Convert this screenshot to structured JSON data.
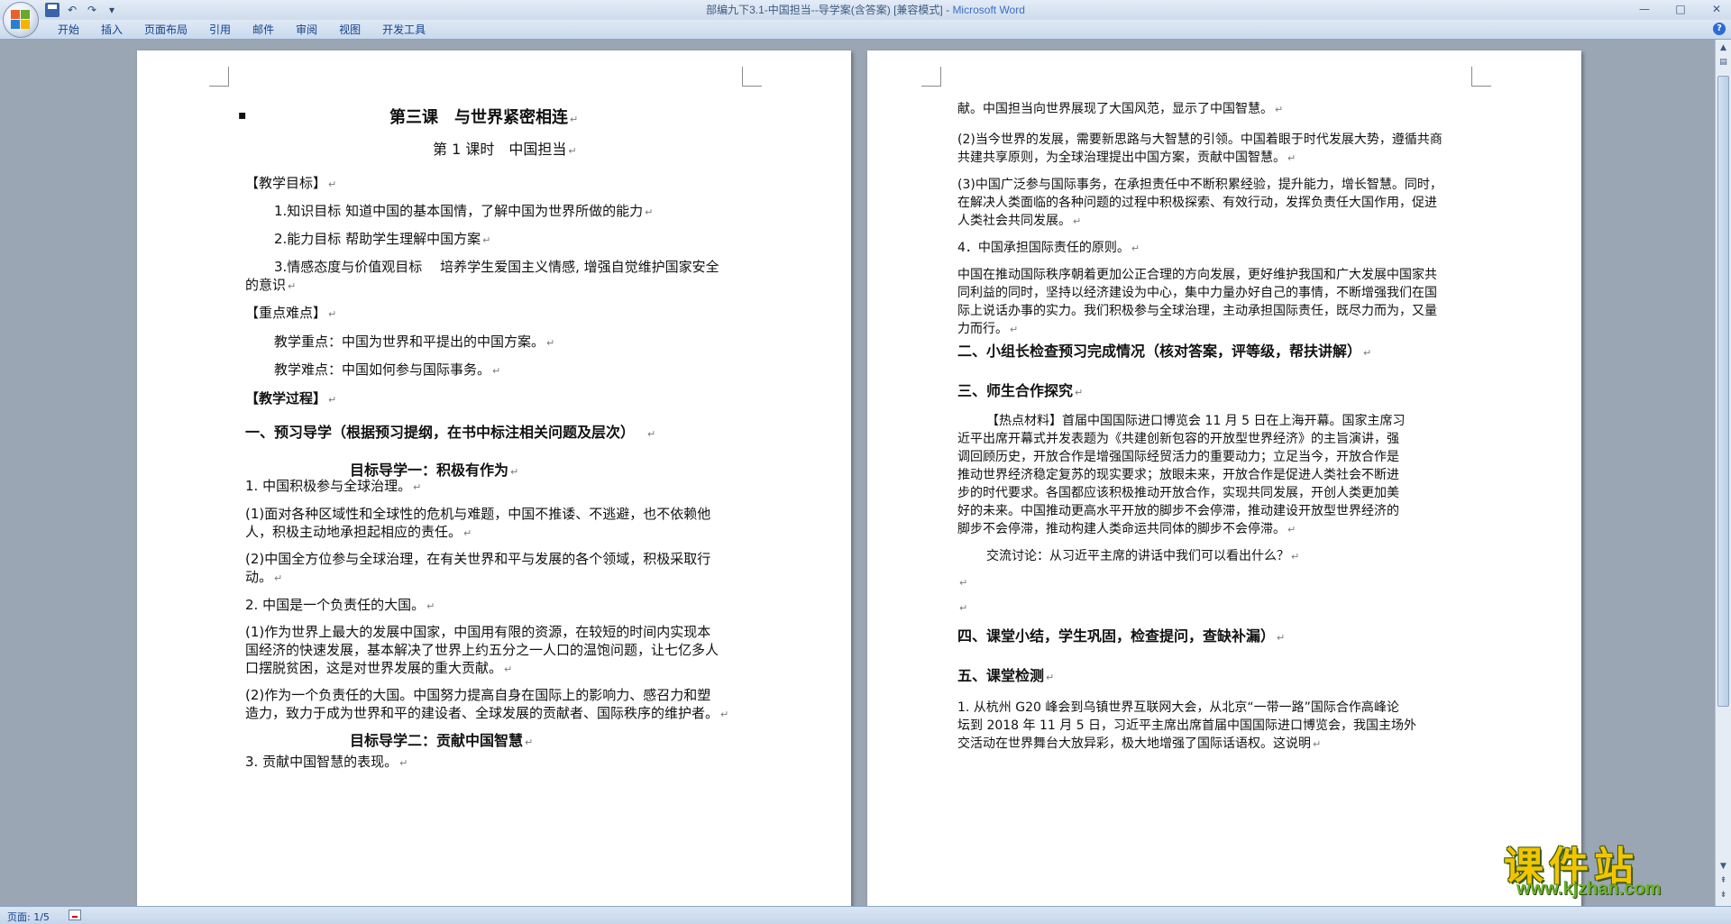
{
  "window": {
    "title": "部编九下3.1-中国担当--导学案(含答案) [兼容模式] - ",
    "app_name": "Microsoft Word",
    "controls": [
      "minimize-icon",
      "maximize-icon",
      "close-icon"
    ]
  },
  "quick_access": [
    "save-icon",
    "undo-icon",
    "redo-icon",
    "customize-icon"
  ],
  "ribbon": {
    "tabs": [
      "开始",
      "插入",
      "页面布局",
      "引用",
      "邮件",
      "审阅",
      "视图",
      "开发工具"
    ]
  },
  "status": {
    "page": "页面: 1/5"
  },
  "watermark": {
    "title": "课件站",
    "url": "www.kjzhan.com"
  },
  "page1": {
    "bullet": "▪",
    "title": "第三课　与世界紧密相连",
    "subtitle": "第 1 课时　中国担当",
    "goals_heading": "【教学目标】",
    "goal1": "1.知识目标 知道中国的基本国情，了解中国为世界所做的能力",
    "goal2": "2.能力目标 帮助学生理解中国方案",
    "goal3a": "3.情感态度与价值观目标　 培养学生爱国主义情感, 增强自觉维护国家安全",
    "goal3b": "的意识",
    "key_heading": "【重点难点】",
    "key1": "教学重点：中国为世界和平提出的中国方案。",
    "key2": "教学难点：中国如何参与国际事务。",
    "process_heading": "【教学过程】",
    "sec1": "一、预习导学（根据预习提纲，在书中标注相关问题及层次）",
    "target1": "目标导学一：积极有作为",
    "p1": "1.  中国积极参与全球治理。",
    "p1a1": "(1)面对各种区域性和全球性的危机与难题，中国不推诿、不逃避，也不依赖他",
    "p1a2": "人，积极主动地承担起相应的责任。",
    "p1b1": "(2)中国全方位参与全球治理，在有关世界和平与发展的各个领域，积极采取行",
    "p1b2": "动。",
    "p2": "2.  中国是一个负责任的大国。",
    "p2a1": "(1)作为世界上最大的发展中国家，中国用有限的资源，在较短的时间内实现本",
    "p2a2": "国经济的快速发展，基本解决了世界上约五分之一人口的温饱问题，让七亿多人",
    "p2a3": "口摆脱贫困，这是对世界发展的重大贡献。",
    "p2b1": "(2)作为一个负责任的大国。中国努力提高自身在国际上的影响力、感召力和塑",
    "p2b2": "造力，致力于成为世界和平的建设者、全球发展的贡献者、国际秩序的维护者。",
    "target2": "目标导学二：贡献中国智慧",
    "p3": "3.  贡献中国智慧的表现。"
  },
  "page2": {
    "l1": "献。中国担当向世界展现了大国风范，显示了中国智慧。",
    "a1": "(2)当今世界的发展，需要新思路与大智慧的引领。中国着眼于时代发展大势，遵循共商",
    "a2": "共建共享原则，为全球治理提出中国方案，贡献中国智慧。",
    "b1": "(3)中国广泛参与国际事务，在承担责任中不断积累经验，提升能力，增长智慧。同时，",
    "b2": "在解决人类面临的各种问题的过程中积极探索、有效行动，发挥负责任大国作用，促进",
    "b3": "人类社会共同发展。",
    "c": "4．中国承担国际责任的原则。",
    "d1": "中国在推动国际秩序朝着更加公正合理的方向发展，更好维护我国和广大发展中国家共",
    "d2": "同利益的同时，坚持以经济建设为中心，集中力量办好自己的事情，不断增强我们在国",
    "d3": "际上说话办事的实力。我们积极参与全球治理，主动承担国际责任，既尽力而为，又量",
    "d4": "力而行。",
    "sec2": "二、小组长检查预习完成情况（核对答案，评等级，帮扶讲解）",
    "sec3": "三、师生合作探究",
    "e1": "【热点材料】首届中国国际进口博览会 11 月 5 日在上海开幕。国家主席习",
    "e2": "近平出席开幕式并发表题为《共建创新包容的开放型世界经济》的主旨演讲，强",
    "e3": "调回顾历史，开放合作是增强国际经贸活力的重要动力；立足当今，开放合作是",
    "e4": "推动世界经济稳定复苏的现实要求；放眼未来，开放合作是促进人类社会不断进",
    "e5": "步的时代要求。各国都应该积极推动开放合作，实现共同发展，开创人类更加美",
    "e6": "好的未来。中国推动更高水平开放的脚步不会停滞，推动建设开放型世界经济的",
    "e7": "脚步不会停滞，推动构建人类命运共同体的脚步不会停滞。",
    "discuss": "交流讨论：从习近平主席的讲话中我们可以看出什么？",
    "sec4": "四、课堂小结，学生巩固，检查提问，查缺补漏）",
    "sec5": "五、课堂检测",
    "f1": "1. 从杭州 G20 峰会到乌镇世界互联网大会，从北京“一带一路”国际合作高峰论",
    "f2": "坛到 2018 年 11 月 5 日，习近平主席出席首届中国国际进口博览会，我国主场外",
    "f3": "交活动在世界舞台大放异彩，极大地增强了国际话语权。这说明"
  },
  "paragraph_mark": "↵"
}
